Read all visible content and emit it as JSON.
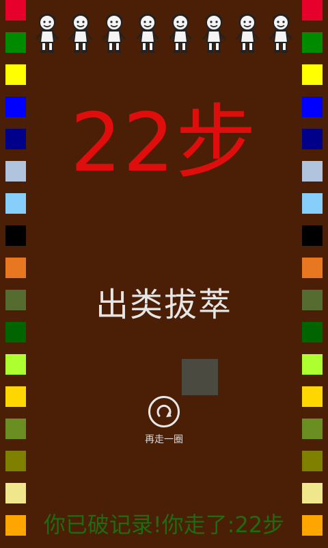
{
  "result": {
    "steps_text": "22步",
    "rank_text": "出类拔萃",
    "replay_label": "再走一圈",
    "record_text": "你已破记录!你走了:22步"
  },
  "figures": [
    "boy-cap-icon",
    "boy-cap-icon",
    "boy-bag-icon",
    "girl-braids-icon",
    "boy-smile-icon",
    "girl-bob-icon",
    "girl-ribbon-icon",
    "boy-hat-icon"
  ],
  "border_colors": [
    "#e8002d",
    "#008a00",
    "#ffff00",
    "#0000ff",
    "#00008b",
    "#b0c4de",
    "#87cefa",
    "#000000",
    "#e87722",
    "#556b2f",
    "#006400",
    "#adff2f",
    "#ffd700",
    "#6b8e23",
    "#808000",
    "#f0e68c",
    "#ffa500"
  ]
}
